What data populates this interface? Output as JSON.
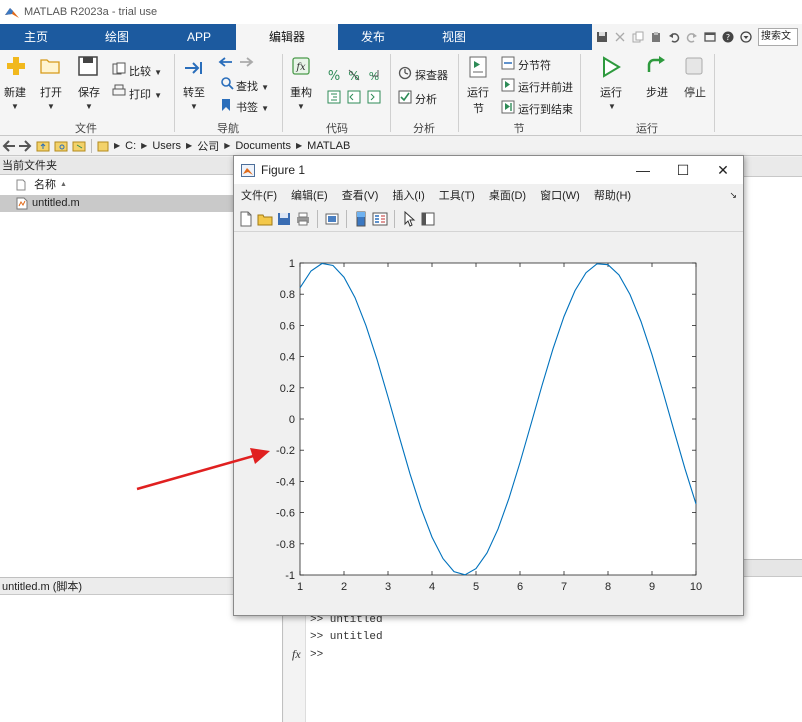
{
  "window": {
    "title": "MATLAB R2023a - trial use"
  },
  "tabs": [
    {
      "label": "主页",
      "active": false
    },
    {
      "label": "绘图",
      "active": false
    },
    {
      "label": "APP",
      "active": false
    },
    {
      "label": "编辑器",
      "active": true
    },
    {
      "label": "发布",
      "active": false
    },
    {
      "label": "视图",
      "active": false
    }
  ],
  "search": {
    "placeholder": "搜索文"
  },
  "ribbon": {
    "file": {
      "new": "新建",
      "open": "打开",
      "save": "保存",
      "compare": "比较",
      "print": "打印",
      "group": "文件"
    },
    "nav": {
      "goto": "转至",
      "find": "查找",
      "bookmark": "书签",
      "group": "导航"
    },
    "code": {
      "refactor": "重构",
      "group": "代码"
    },
    "analyze": {
      "inspector": "探查器",
      "analyze": "分析",
      "group": "分析"
    },
    "section": {
      "run_section_l1": "运行",
      "run_section_l2": "节",
      "section_break": "分节符",
      "run_advance": "运行并前进",
      "run_to_end": "运行到结束",
      "group": "节"
    },
    "run": {
      "run": "运行",
      "step": "步进",
      "stop": "停止",
      "group": "运行"
    }
  },
  "address": {
    "crumbs": [
      "C:",
      "Users",
      "公司",
      "Documents",
      "MATLAB"
    ]
  },
  "file_panel": {
    "title": "当前文件夹",
    "column_name": "名称",
    "files": [
      {
        "name": "untitled.m"
      }
    ],
    "details_title": "untitled.m  (脚本)"
  },
  "command_window": {
    "lines": [
      ">> untitled",
      ">> untitled"
    ],
    "prompt": ">>",
    "fx_label": "fx"
  },
  "figure": {
    "title": "Figure 1",
    "menu": [
      "文件(F)",
      "编辑(E)",
      "查看(V)",
      "插入(I)",
      "工具(T)",
      "桌面(D)",
      "窗口(W)",
      "帮助(H)"
    ],
    "controls": {
      "minimize": "—",
      "maximize": "☐",
      "close": "✕"
    }
  },
  "colors": {
    "tab_bar": "#1c5a9f",
    "line": "#0072bd",
    "arrow": "#e02020"
  },
  "chart_data": {
    "type": "line",
    "function": "sin(x)",
    "title": "",
    "xlabel": "",
    "ylabel": "",
    "xlim": [
      1,
      10
    ],
    "ylim": [
      -1,
      1
    ],
    "xticks": [
      1,
      2,
      3,
      4,
      5,
      6,
      7,
      8,
      9,
      10
    ],
    "yticks": [
      -1,
      -0.8,
      -0.6,
      -0.4,
      -0.2,
      0,
      0.2,
      0.4,
      0.6,
      0.8,
      1
    ],
    "grid": false,
    "series": [
      {
        "x": [
          1,
          1.25,
          1.5,
          1.75,
          2,
          2.25,
          2.5,
          2.75,
          3,
          3.25,
          3.5,
          3.75,
          4,
          4.25,
          4.5,
          4.75,
          5,
          5.25,
          5.5,
          5.75,
          6,
          6.25,
          6.5,
          6.75,
          7,
          7.25,
          7.5,
          7.75,
          8,
          8.25,
          8.5,
          8.75,
          9,
          9.25,
          9.5,
          9.75,
          10
        ],
        "y": [
          0.841,
          0.949,
          0.997,
          0.984,
          0.909,
          0.778,
          0.598,
          0.382,
          0.141,
          -0.108,
          -0.351,
          -0.572,
          -0.757,
          -0.895,
          -0.978,
          -0.999,
          -0.959,
          -0.859,
          -0.706,
          -0.508,
          -0.279,
          -0.033,
          0.215,
          0.45,
          0.657,
          0.823,
          0.938,
          0.995,
          0.989,
          0.923,
          0.798,
          0.625,
          0.412,
          0.174,
          -0.075,
          -0.319,
          -0.544
        ]
      }
    ]
  }
}
